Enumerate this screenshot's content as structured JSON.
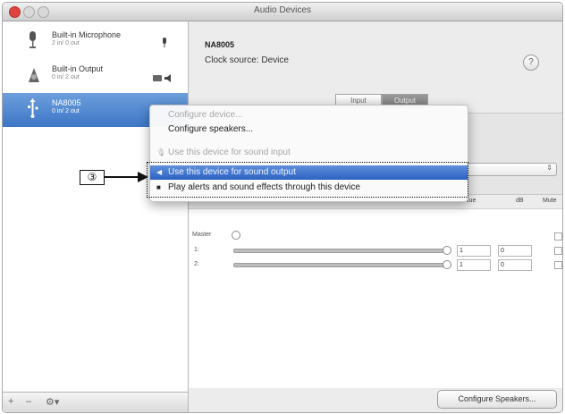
{
  "window": {
    "title": "Audio Devices"
  },
  "sidebar": {
    "devices": [
      {
        "name": "Built-in Microphone",
        "sub": "2 in/ 0 out",
        "icon": "microphone-icon"
      },
      {
        "name": "Built-in Output",
        "sub": "0 in/ 2 out",
        "icon": "speaker-icon"
      },
      {
        "name": "NA8005",
        "sub": "0 in/ 2 out",
        "icon": "usb-icon",
        "selected": true
      }
    ],
    "buttons": {
      "add": "+",
      "remove": "–",
      "gear": "⚙▾"
    }
  },
  "main": {
    "device_title": "NA8005",
    "clock_source": "Clock source: Device",
    "help": "?",
    "tabs": [
      "Input",
      "Output"
    ],
    "active_tab": "Output",
    "grid_headers": [
      "Value",
      "dB",
      "Mute"
    ],
    "channels": [
      {
        "label": "Master"
      },
      {
        "label": "1:",
        "value": "1",
        "db": "0"
      },
      {
        "label": "2:",
        "value": "1",
        "db": "0"
      }
    ],
    "configure_button": "Configure Speakers..."
  },
  "context_menu": {
    "items": [
      {
        "label": "Configure device...",
        "state": "disabled"
      },
      {
        "label": "Configure speakers...",
        "state": "enabled"
      },
      {
        "label": "Use this device for sound input",
        "state": "disabled",
        "icon": "microphone-icon"
      },
      {
        "label": "Use this device for sound output",
        "state": "highlight",
        "icon": "speaker-icon"
      },
      {
        "label": "Play alerts and sound effects through this device",
        "state": "enabled",
        "icon": "alert-speaker-icon"
      }
    ]
  },
  "callout": {
    "label": "③"
  },
  "colors": {
    "selection": "#3d76c6",
    "menu_highlight": "#2c62c4",
    "close_button": "#e0443e"
  }
}
